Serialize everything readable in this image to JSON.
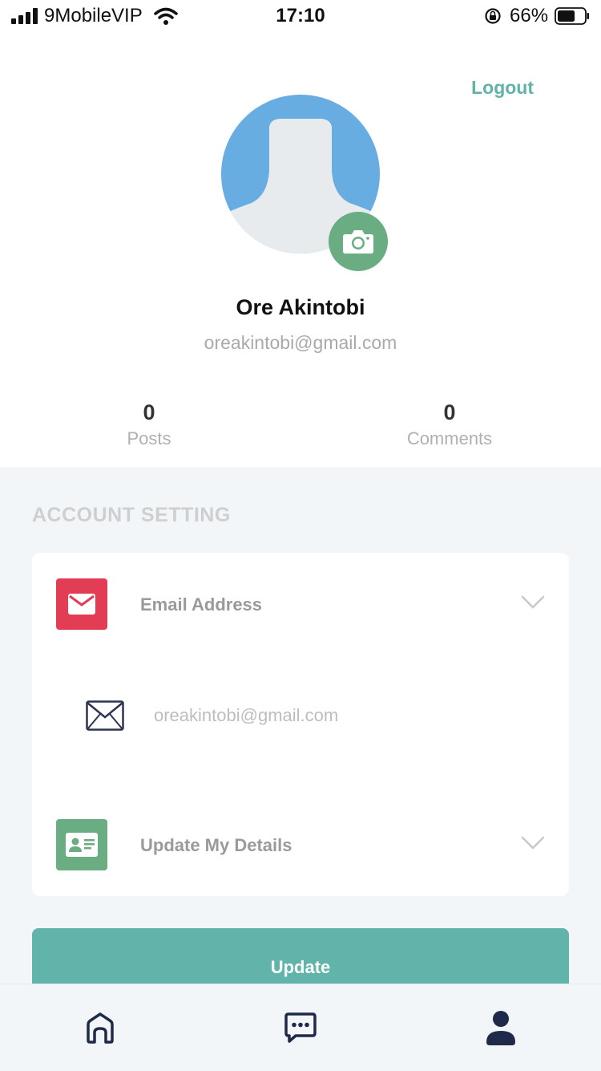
{
  "status_bar": {
    "carrier": "9MobileVIP",
    "time": "17:10",
    "battery_percent": "66%",
    "battery_level": 0.66,
    "icons": [
      "signal-icon",
      "wifi-icon",
      "orientation-lock-icon",
      "battery-icon"
    ]
  },
  "header": {
    "logout_label": "Logout"
  },
  "profile": {
    "name": "Ore Akintobi",
    "email": "oreakintobi@gmail.com",
    "camera_icon": "camera-icon"
  },
  "stats": {
    "posts": {
      "value": "0",
      "label": "Posts"
    },
    "comments": {
      "value": "0",
      "label": "Comments"
    }
  },
  "account_setting": {
    "title": "ACCOUNT SETTING",
    "email_row": {
      "label": "Email Address",
      "value": "oreakintobi@gmail.com",
      "icon": "mail-icon",
      "expanded": true
    },
    "details_row": {
      "label": "Update My Details",
      "icon": "id-card-icon",
      "expanded": false
    }
  },
  "actions": {
    "update_label": "Update"
  },
  "tab_bar": {
    "items": [
      "home-icon",
      "chat-icon",
      "profile-icon"
    ],
    "active": "profile-icon"
  },
  "colors": {
    "accent": "#5fb3a7",
    "avatar_bg": "#68ade2",
    "camera_bg": "#6aad82",
    "email_icon_bg": "#e33c55",
    "details_icon_bg": "#6aad82",
    "update_button": "#61b4a9",
    "settings_bg": "#f3f6f9"
  }
}
